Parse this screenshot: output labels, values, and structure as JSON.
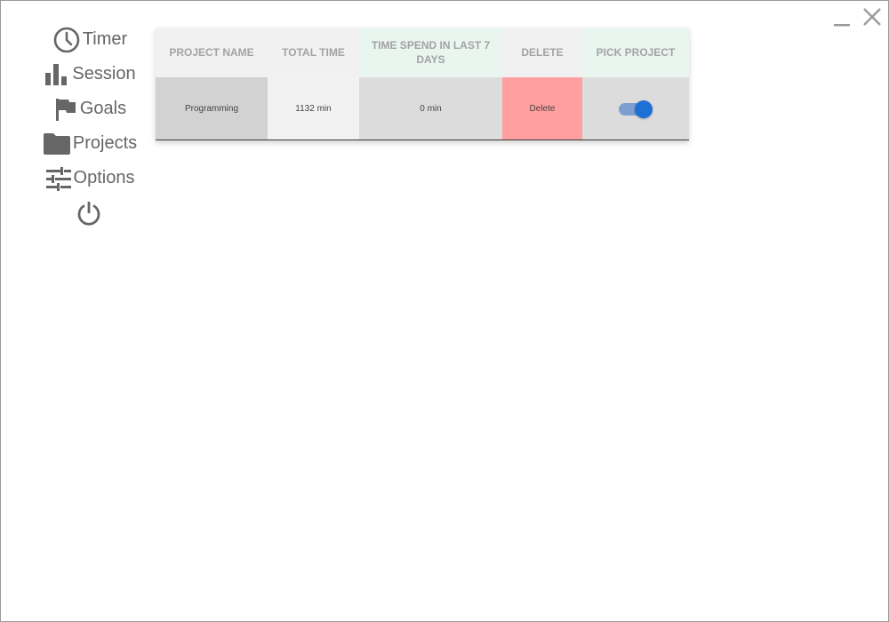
{
  "nav": {
    "items": [
      {
        "label": "Timer",
        "icon": "clock-icon"
      },
      {
        "label": "Session",
        "icon": "bar-chart-icon"
      },
      {
        "label": "Goals",
        "icon": "flag-icon"
      },
      {
        "label": "Projects",
        "icon": "folder-icon"
      },
      {
        "label": "Options",
        "icon": "sliders-icon"
      },
      {
        "label": "",
        "icon": "power-icon"
      }
    ]
  },
  "table": {
    "headers": {
      "project_name": "PROJECT NAME",
      "total_time": "TOTAL TIME",
      "last7": "TIME SPEND IN LAST 7 DAYS",
      "delete": "DELETE",
      "pick": "PICK PROJECT"
    },
    "rows": [
      {
        "project_name": "Programming",
        "total_time": "1132 min",
        "last7": "0 min",
        "delete_label": "Delete",
        "picked": true
      }
    ]
  },
  "colors": {
    "delete_bg": "#ff9f9f",
    "toggle_on": "#1e6fd6",
    "header_green": "#e9f5ef"
  }
}
